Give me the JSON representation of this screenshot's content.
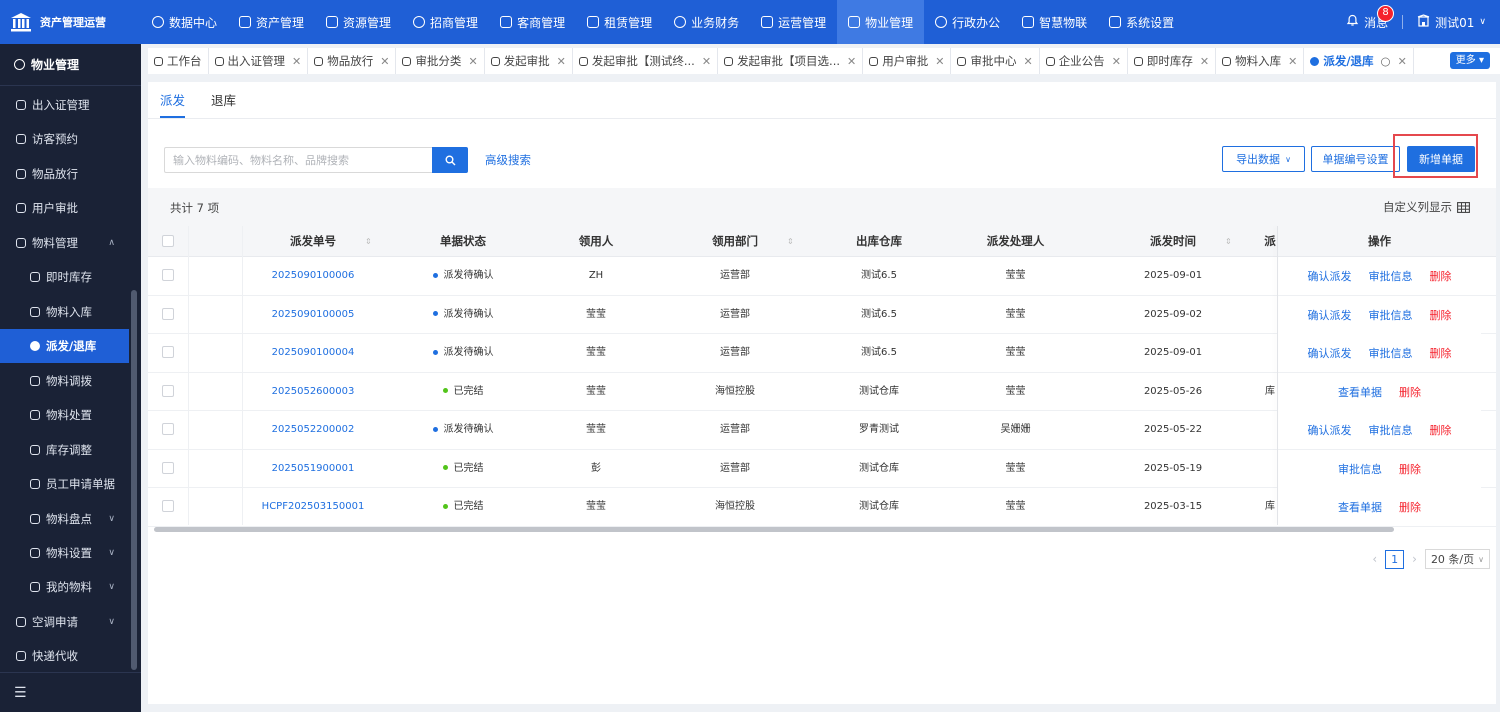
{
  "app": {
    "title": "资产管理运营"
  },
  "topnav": [
    {
      "label": "数据中心",
      "icon": "dashboard-icon",
      "active": false
    },
    {
      "label": "资产管理",
      "icon": "cube-icon",
      "active": false
    },
    {
      "label": "资源管理",
      "icon": "document-icon",
      "active": false
    },
    {
      "label": "招商管理",
      "icon": "tag-icon",
      "active": false
    },
    {
      "label": "客商管理",
      "icon": "people-icon",
      "active": false
    },
    {
      "label": "租赁管理",
      "icon": "building-icon",
      "active": false
    },
    {
      "label": "业务财务",
      "icon": "coin-icon",
      "active": false
    },
    {
      "label": "运营管理",
      "icon": "operation-icon",
      "active": false
    },
    {
      "label": "物业管理",
      "icon": "home-icon",
      "active": true
    },
    {
      "label": "行政办公",
      "icon": "briefcase-icon",
      "active": false
    },
    {
      "label": "智慧物联",
      "icon": "iot-icon",
      "active": false
    },
    {
      "label": "系统设置",
      "icon": "gear-icon",
      "active": false
    }
  ],
  "header": {
    "message_label": "消息",
    "message_count": "8",
    "user_name": "测试01"
  },
  "sidebar": {
    "title": "物业管理",
    "items": [
      {
        "label": "出入证管理",
        "level": 1,
        "chevron": ""
      },
      {
        "label": "访客预约",
        "level": 1,
        "chevron": ""
      },
      {
        "label": "物品放行",
        "level": 1,
        "chevron": ""
      },
      {
        "label": "用户审批",
        "level": 1,
        "chevron": ""
      },
      {
        "label": "物料管理",
        "level": 1,
        "chevron": "up"
      },
      {
        "label": "即时库存",
        "level": 2,
        "chevron": ""
      },
      {
        "label": "物料入库",
        "level": 2,
        "chevron": ""
      },
      {
        "label": "派发/退库",
        "level": 2,
        "chevron": "",
        "active": true
      },
      {
        "label": "物料调拨",
        "level": 2,
        "chevron": ""
      },
      {
        "label": "物料处置",
        "level": 2,
        "chevron": ""
      },
      {
        "label": "库存调整",
        "level": 2,
        "chevron": ""
      },
      {
        "label": "员工申请单据",
        "level": 2,
        "chevron": ""
      },
      {
        "label": "物料盘点",
        "level": 2,
        "chevron": "down"
      },
      {
        "label": "物料设置",
        "level": 2,
        "chevron": "down"
      },
      {
        "label": "我的物料",
        "level": 2,
        "chevron": "down"
      },
      {
        "label": "空调申请",
        "level": 1,
        "chevron": "down"
      },
      {
        "label": "快递代收",
        "level": 1,
        "chevron": ""
      }
    ]
  },
  "tabs": [
    {
      "label": "工作台",
      "closable": false
    },
    {
      "label": "出入证管理",
      "closable": true
    },
    {
      "label": "物品放行",
      "closable": true
    },
    {
      "label": "审批分类",
      "closable": true
    },
    {
      "label": "发起审批",
      "closable": true
    },
    {
      "label": "发起审批【测试终...",
      "closable": true
    },
    {
      "label": "发起审批【项目选...",
      "closable": true
    },
    {
      "label": "用户审批",
      "closable": true
    },
    {
      "label": "审批中心",
      "closable": true
    },
    {
      "label": "企业公告",
      "closable": true
    },
    {
      "label": "即时库存",
      "closable": true
    },
    {
      "label": "物料入库",
      "closable": true
    },
    {
      "label": "派发/退库",
      "closable": true,
      "active": true
    }
  ],
  "tabs_more": "更多",
  "subtabs": [
    "派发",
    "退库"
  ],
  "search": {
    "placeholder": "输入物料编码、物料名称、品牌搜索",
    "advanced": "高级搜索"
  },
  "toolbar": {
    "export": "导出数据",
    "numbering": "单据编号设置",
    "new": "新增单据"
  },
  "table": {
    "count_label": "共计 7 项",
    "custom_columns": "自定义列显示",
    "columns": [
      "派发单号",
      "单据状态",
      "领用人",
      "领用部门",
      "出库仓库",
      "派发处理人",
      "派发时间",
      "派",
      "操作"
    ],
    "rows": [
      {
        "no": "2025090100006",
        "status": "派发待确认",
        "status_color": "#1f6fe0",
        "user": "ZH",
        "dept": "运营部",
        "warehouse": "测试6.5",
        "handler": "莹莹",
        "time": "2025-09-01",
        "extra": "",
        "actions": [
          "确认派发",
          "审批信息",
          "删除"
        ]
      },
      {
        "no": "2025090100005",
        "status": "派发待确认",
        "status_color": "#1f6fe0",
        "user": "莹莹",
        "dept": "运营部",
        "warehouse": "测试6.5",
        "handler": "莹莹",
        "time": "2025-09-02",
        "extra": "",
        "actions": [
          "确认派发",
          "审批信息",
          "删除"
        ]
      },
      {
        "no": "2025090100004",
        "status": "派发待确认",
        "status_color": "#1f6fe0",
        "user": "莹莹",
        "dept": "运营部",
        "warehouse": "测试6.5",
        "handler": "莹莹",
        "time": "2025-09-01",
        "extra": "",
        "actions": [
          "确认派发",
          "审批信息",
          "删除"
        ]
      },
      {
        "no": "2025052600003",
        "status": "已完结",
        "status_color": "#52c41a",
        "user": "莹莹",
        "dept": "海恒控股",
        "warehouse": "测试仓库",
        "handler": "莹莹",
        "time": "2025-05-26",
        "extra": "库",
        "actions": [
          "查看单据",
          "删除"
        ]
      },
      {
        "no": "2025052200002",
        "status": "派发待确认",
        "status_color": "#1f6fe0",
        "user": "莹莹",
        "dept": "运营部",
        "warehouse": "罗青测试",
        "handler": "吴姗姗",
        "time": "2025-05-22",
        "extra": "",
        "actions": [
          "确认派发",
          "审批信息",
          "删除"
        ]
      },
      {
        "no": "2025051900001",
        "status": "已完结",
        "status_color": "#52c41a",
        "user": "彭",
        "dept": "运营部",
        "warehouse": "测试仓库",
        "handler": "莹莹",
        "time": "2025-05-19",
        "extra": "",
        "actions": [
          "审批信息",
          "删除"
        ]
      },
      {
        "no": "HCPF202503150001",
        "status": "已完结",
        "status_color": "#52c41a",
        "user": "莹莹",
        "dept": "海恒控股",
        "warehouse": "测试仓库",
        "handler": "莹莹",
        "time": "2025-03-15",
        "extra": "库",
        "actions": [
          "查看单据",
          "删除"
        ]
      }
    ]
  },
  "pagination": {
    "current": "1",
    "page_size": "20 条/页"
  }
}
